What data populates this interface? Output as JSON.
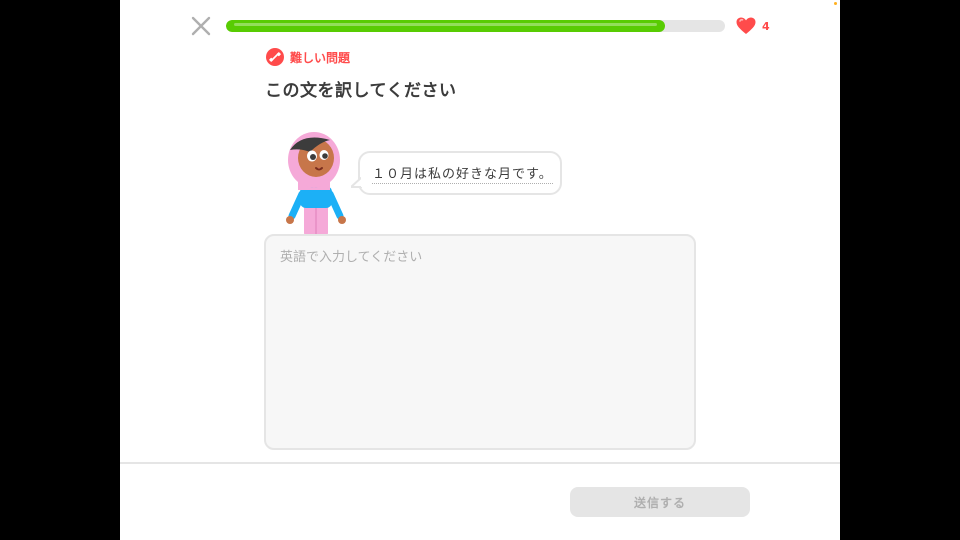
{
  "header": {
    "progress_fraction": 0.88,
    "progress_color": "#58cc02",
    "hearts_count": "4",
    "heart_color": "#ff4b4b",
    "close_icon": "close-icon",
    "heart_icon": "heart-icon"
  },
  "challenge": {
    "badge_label": "難しい問題",
    "badge_icon": "weight-icon",
    "badge_color": "#ff4b4b",
    "title": "この文を訳してください",
    "sentence": "１０月は私の好きな月です。"
  },
  "answer": {
    "placeholder": "英語で入力してください",
    "value": ""
  },
  "footer": {
    "submit_label": "送信する",
    "submit_state": "disabled"
  }
}
